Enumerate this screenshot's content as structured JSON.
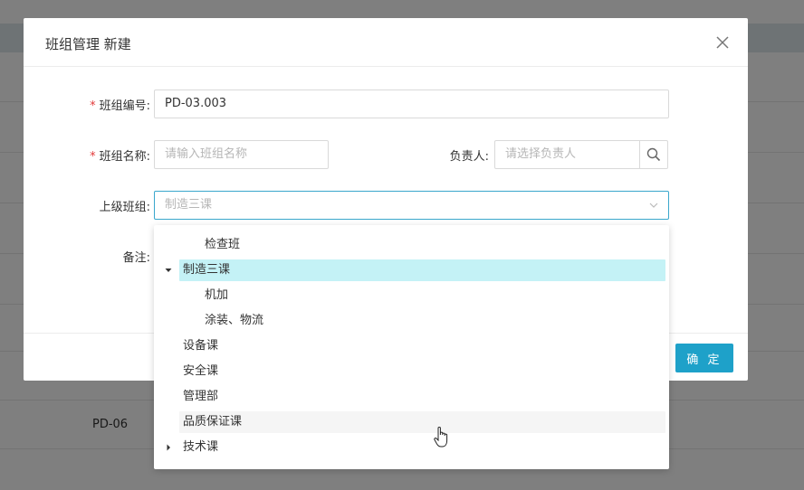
{
  "modal": {
    "title": "班组管理 新建",
    "ok_label": "确 定"
  },
  "form": {
    "code": {
      "label": "班组编号:",
      "value": "PD-03.003",
      "required": true
    },
    "name": {
      "label": "班组名称:",
      "placeholder": "请输入班组名称",
      "required": true
    },
    "leader": {
      "label": "负责人:",
      "placeholder": "请选择负责人"
    },
    "parent": {
      "label": "上级班组:",
      "placeholder": "制造三课"
    },
    "remark": {
      "label": "备注:"
    }
  },
  "background": {
    "row_value": "PD-06"
  },
  "tree": [
    {
      "label": "检查班",
      "level": 1,
      "state": "normal"
    },
    {
      "label": "制造三课",
      "level": 0,
      "state": "selected",
      "expander": "expanded"
    },
    {
      "label": "机加",
      "level": 1,
      "state": "normal"
    },
    {
      "label": "涂装、物流",
      "level": 1,
      "state": "normal"
    },
    {
      "label": "设备课",
      "level": 0,
      "state": "normal"
    },
    {
      "label": "安全课",
      "level": 0,
      "state": "normal"
    },
    {
      "label": "管理部",
      "level": 0,
      "state": "normal"
    },
    {
      "label": "品质保证课",
      "level": 0,
      "state": "hover"
    },
    {
      "label": "技术课",
      "level": 0,
      "state": "normal",
      "expander": "collapsed"
    }
  ],
  "colors": {
    "primary": "#1ea1c9",
    "selected_bg": "#c4f2f6",
    "hover_bg": "#f5f5f5",
    "required": "#e23b3b"
  },
  "icons": [
    "close-icon",
    "search-icon",
    "chevron-down-icon",
    "caret-down-icon",
    "caret-right-icon",
    "hand-cursor-icon"
  ]
}
